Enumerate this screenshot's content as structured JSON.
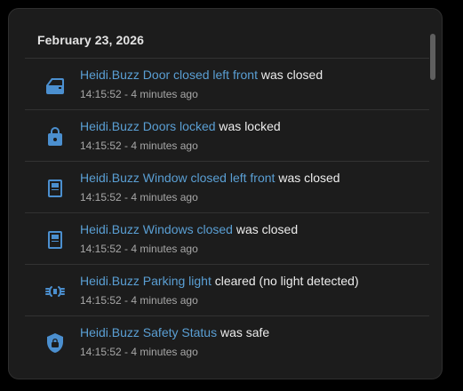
{
  "logbook": {
    "date": "February 23, 2026",
    "entries": [
      {
        "icon": "car-door-icon",
        "entity": "Heidi.Buzz Door closed left front",
        "message": "was closed",
        "time": "14:15:52 - 4 minutes ago"
      },
      {
        "icon": "lock-icon",
        "entity": "Heidi.Buzz Doors locked",
        "message": "was locked",
        "time": "14:15:52 - 4 minutes ago"
      },
      {
        "icon": "window-closed-icon",
        "entity": "Heidi.Buzz Window closed left front",
        "message": "was closed",
        "time": "14:15:52 - 4 minutes ago"
      },
      {
        "icon": "window-closed-icon",
        "entity": "Heidi.Buzz Windows closed",
        "message": "was closed",
        "time": "14:15:52 - 4 minutes ago"
      },
      {
        "icon": "parking-light-icon",
        "entity": "Heidi.Buzz Parking light",
        "message": "cleared (no light detected)",
        "time": "14:15:52 - 4 minutes ago"
      },
      {
        "icon": "shield-lock-icon",
        "entity": "Heidi.Buzz Safety Status",
        "message": "was safe",
        "time": "14:15:52 - 4 minutes ago"
      }
    ]
  },
  "colors": {
    "accent": "#5a9fd4",
    "icon": "#4b8fcf",
    "card_background": "#1c1c1c",
    "text_primary": "#ececec",
    "text_secondary": "#a7a7a7"
  }
}
